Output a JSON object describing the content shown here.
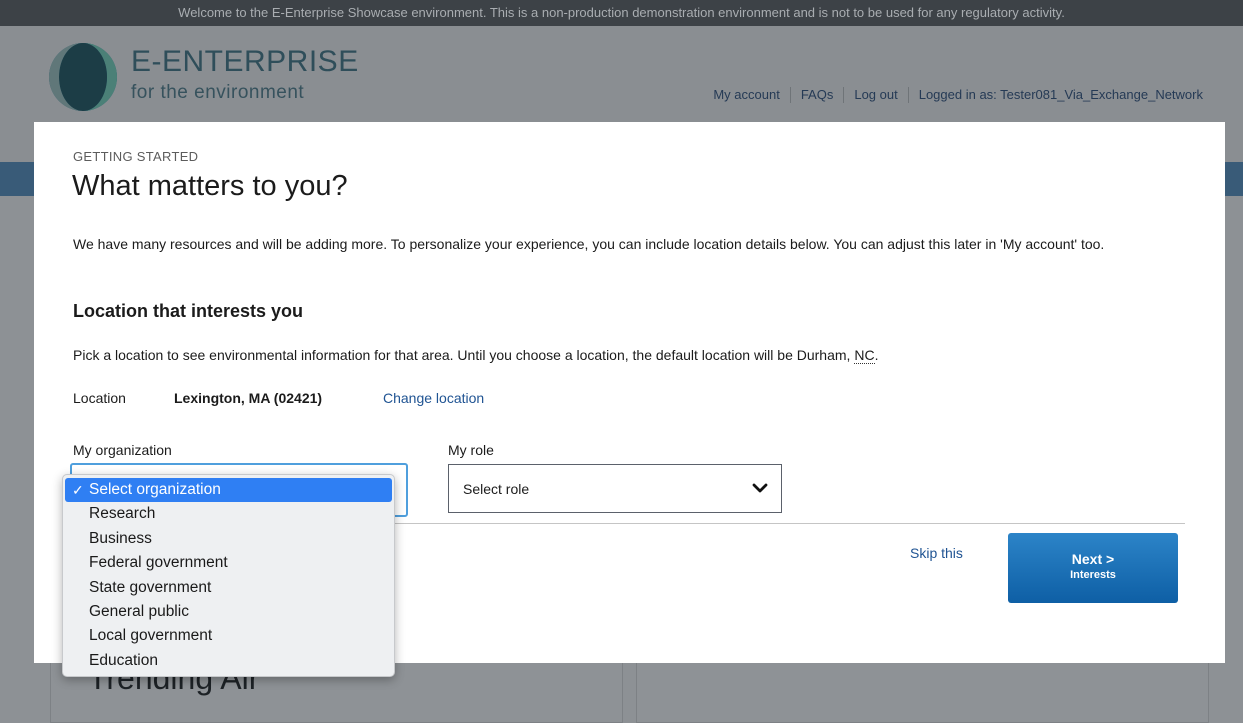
{
  "banner": "Welcome to the E-Enterprise Showcase environment. This is a non-production demonstration environment and is not to be used for any regulatory activity.",
  "logo": {
    "title": "E-ENTERPRISE",
    "subtitle": "for the environment"
  },
  "top_nav": {
    "my_account": "My account",
    "faqs": "FAQs",
    "log_out": "Log out",
    "logged_in": "Logged in as: Tester081_Via_Exchange_Network"
  },
  "background": {
    "card_title": "Trending Air"
  },
  "modal": {
    "eyebrow": "GETTING STARTED",
    "title": "What matters to you?",
    "intro": "We have many resources and will be adding more. To personalize your experience, you can include location details below. You can adjust this later in 'My account' too.",
    "location_heading": "Location that interests you",
    "pick_text": "Pick a location to see environmental information for that area. Until you choose a location, the default location will be Durham,",
    "pick_state": "NC",
    "pick_end": ".",
    "location_label": "Location",
    "location_value": "Lexington, MA (02421)",
    "change_location": "Change location",
    "org_label": "My organization",
    "role_label": "My role",
    "role_value": "Select role",
    "skip": "Skip this",
    "next_label": "Next >",
    "next_sub": "Interests"
  },
  "org_dropdown": {
    "checkmark": "✓",
    "options": [
      "Select organization",
      "Research",
      "Business",
      "Federal government",
      "State government",
      "General public",
      "Local government",
      "Education"
    ],
    "selected_index": 0
  },
  "colors": {
    "link": "#205493",
    "button": "#0e5fa5",
    "selected_option": "#2f7ff3",
    "focus_border": "#4f9fdd"
  }
}
